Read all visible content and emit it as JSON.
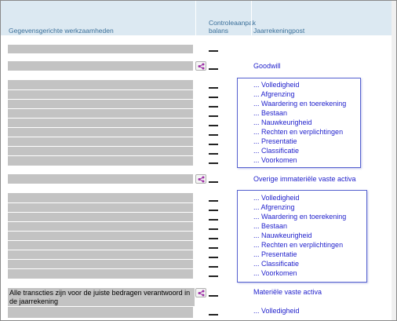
{
  "header": {
    "col_activities": "Gegevensgerichte werkzaamheden",
    "col_approach_line1": "Controleaanpak",
    "col_approach_line2": "balans",
    "col_post": "Jaarrekeningpost"
  },
  "groups": [
    {
      "post": "Goodwill",
      "assertions": [
        "... Volledigheid",
        "... Afgrenzing",
        "... Waardering en toerekening",
        "... Bestaan",
        "... Nauwkeurigheid",
        "... Rechten en verplichtingen",
        "... Presentatie",
        "... Classificatie",
        "... Voorkomen"
      ]
    },
    {
      "post": "Overige immateriële vaste activa",
      "assertions": [
        "... Volledigheid",
        "... Afgrenzing",
        "... Waardering en toerekening",
        "... Bestaan",
        "... Nauwkeurigheid",
        "... Rechten en verplichtingen",
        "... Presentatie",
        "... Classificatie",
        "... Voorkomen"
      ]
    },
    {
      "post": "Materiële vaste activa",
      "activity_text": "Alle transcties zijn voor de juiste bedragen verantwoord in de jaarrekening",
      "assertions": [
        "... Volledigheid"
      ]
    }
  ],
  "colors": {
    "header_bg": "#dce9f2",
    "header_text": "#3a6f99",
    "link": "#2222cc",
    "selection_border": "#5561cf",
    "row_gray": "#c3c3c3"
  },
  "icons": {
    "row_action": "share-nodes-icon"
  }
}
